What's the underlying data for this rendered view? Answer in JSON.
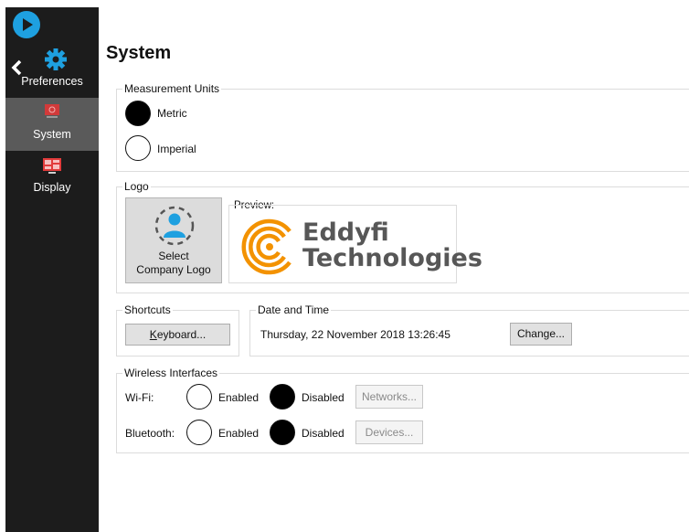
{
  "sidebar": {
    "preferences_label": "Preferences",
    "items": [
      {
        "label": "System",
        "icon": "system-monitor-icon",
        "selected": true
      },
      {
        "label": "Display",
        "icon": "display-panel-icon",
        "selected": false
      }
    ],
    "accent": "#1ea0e0",
    "background": "#1c1c1c",
    "selected_background": "#5a5a5a"
  },
  "page": {
    "title": "System"
  },
  "measurement_units": {
    "title": "Measurement Units",
    "options": [
      {
        "label": "Metric",
        "selected": true
      },
      {
        "label": "Imperial",
        "selected": false
      }
    ]
  },
  "logo": {
    "title": "Logo",
    "select_button_label": "Select Company Logo",
    "preview_label": "Preview:",
    "preview_brand_line1": "Eddyfi",
    "preview_brand_line2": "Technologies",
    "brand_accent": "#f39200"
  },
  "shortcuts": {
    "title": "Shortcuts",
    "keyboard_button": "Keyboard..."
  },
  "date_time": {
    "title": "Date and Time",
    "value": "Thursday, 22 November 2018 13:26:45",
    "change_button": "Change..."
  },
  "wireless": {
    "title": "Wireless Interfaces",
    "wifi": {
      "label": "Wi-Fi:",
      "enabled_label": "Enabled",
      "disabled_label": "Disabled",
      "state": "Disabled",
      "button": "Networks..."
    },
    "bluetooth": {
      "label": "Bluetooth:",
      "enabled_label": "Enabled",
      "disabled_label": "Disabled",
      "state": "Disabled",
      "button": "Devices..."
    }
  }
}
